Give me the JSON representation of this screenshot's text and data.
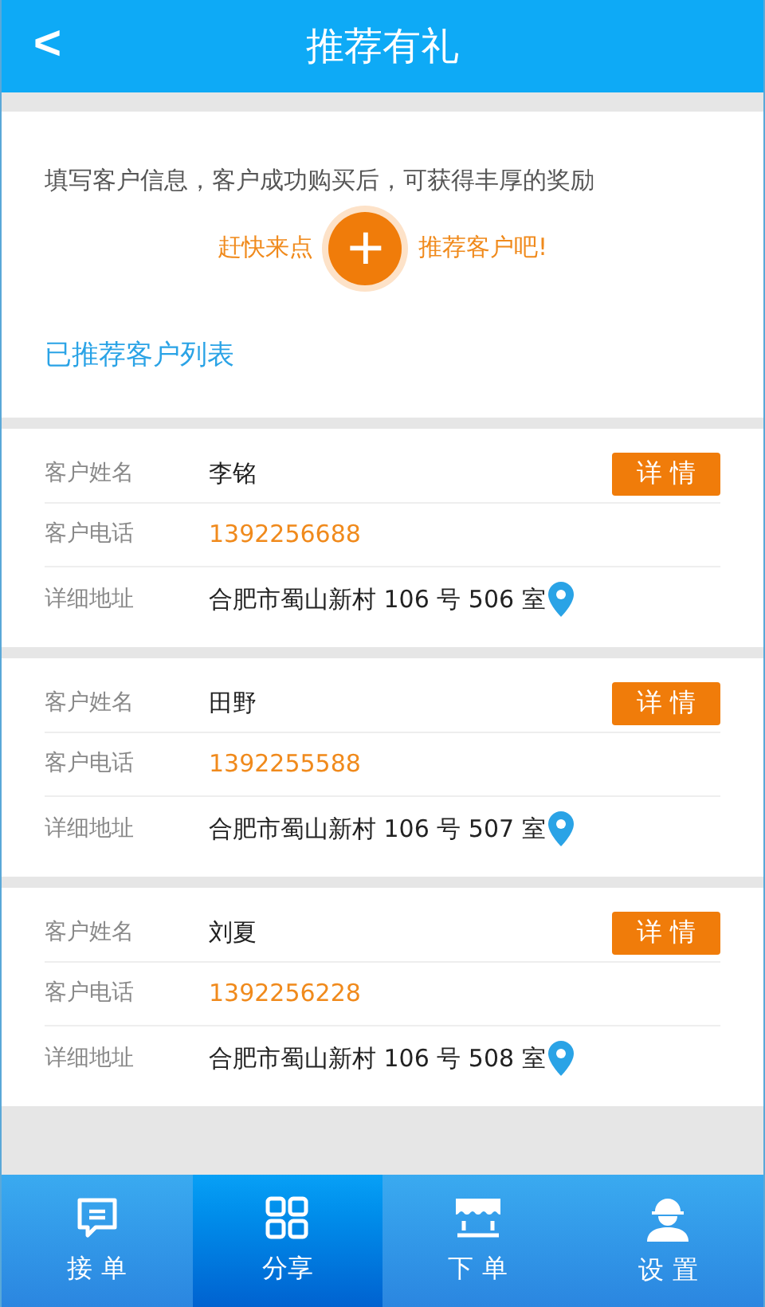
{
  "header": {
    "back": "<",
    "title": "推荐有礼"
  },
  "intro": {
    "text": "填写客户信息，客户成功购买后，可获得丰厚的奖励",
    "cta_left": "赶快来点",
    "cta_plus": "+",
    "cta_right": "推荐客户吧!"
  },
  "list_title": "已推荐客户列表",
  "customers": [
    {
      "name_label": "客户姓名",
      "name": "李铭",
      "detail_button": "详 情",
      "phone_label": "客户电话",
      "phone": "1392256688",
      "address_label": "详细地址",
      "address": "合肥市蜀山新村 106 号 506 室"
    },
    {
      "name_label": "客户姓名",
      "name": "田野",
      "detail_button": "详 情",
      "phone_label": "客户电话",
      "phone": "1392255588",
      "address_label": "详细地址",
      "address": "合肥市蜀山新村 106 号 507 室"
    },
    {
      "name_label": "客户姓名",
      "name": "刘夏",
      "detail_button": "详 情",
      "phone_label": "客户电话",
      "phone": "1392256228",
      "address_label": "详细地址",
      "address": "合肥市蜀山新村 106 号 508 室"
    }
  ],
  "tabs": [
    {
      "kind": "orders",
      "label": "接 单",
      "selected": false
    },
    {
      "kind": "share",
      "label": "分享",
      "selected": true
    },
    {
      "kind": "shop",
      "label": "下 单",
      "selected": false
    },
    {
      "kind": "settings",
      "label": "设 置",
      "selected": false
    }
  ]
}
